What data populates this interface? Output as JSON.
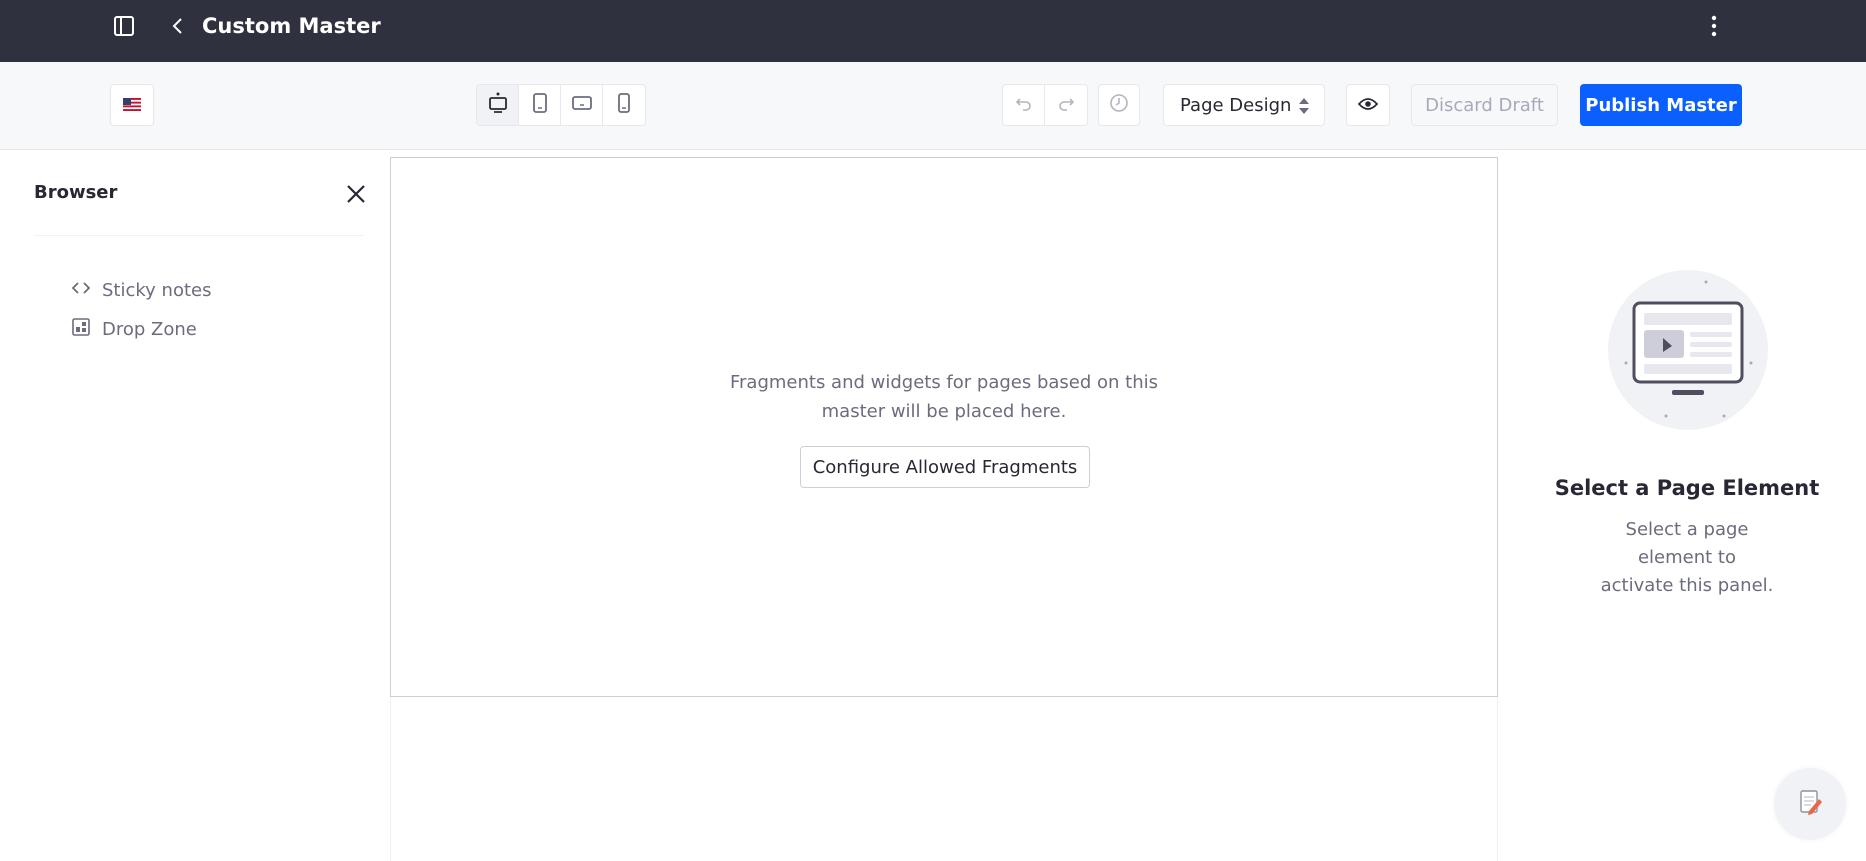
{
  "topbar": {
    "title": "Custom Master",
    "icons": [
      "product-menu-icon",
      "back-icon",
      "kebab-menu-icon"
    ]
  },
  "toolbar": {
    "locale_icon": "us-flag-icon",
    "device_buttons": [
      {
        "icon": "desktop-icon",
        "active": true
      },
      {
        "icon": "tablet-icon",
        "active": false
      },
      {
        "icon": "landscape-phone-icon",
        "active": false
      },
      {
        "icon": "portrait-phone-icon",
        "active": false
      }
    ],
    "undo_icon": "undo-icon",
    "redo_icon": "redo-icon",
    "history_icon": "history-icon",
    "mode_select": "Page Design",
    "preview_icon": "eye-icon",
    "discard_label": "Discard Draft",
    "publish_label": "Publish Master"
  },
  "sidebar": {
    "title": "Browser",
    "items": [
      {
        "icon": "code-icon",
        "label": "Sticky notes"
      },
      {
        "icon": "drop-zone-icon",
        "label": "Drop Zone"
      }
    ]
  },
  "canvas": {
    "message_line1": "Fragments and widgets for pages based on this",
    "message_line2": "master will be placed here.",
    "configure_label": "Configure Allowed Fragments"
  },
  "right_panel": {
    "title": "Select a Page Element",
    "desc_line1": "Select a page element to",
    "desc_line2": "activate this panel."
  },
  "colors": {
    "topbar_bg": "#30313f",
    "primary": "#0b5fff",
    "secondary_text": "#6b6c7e"
  }
}
